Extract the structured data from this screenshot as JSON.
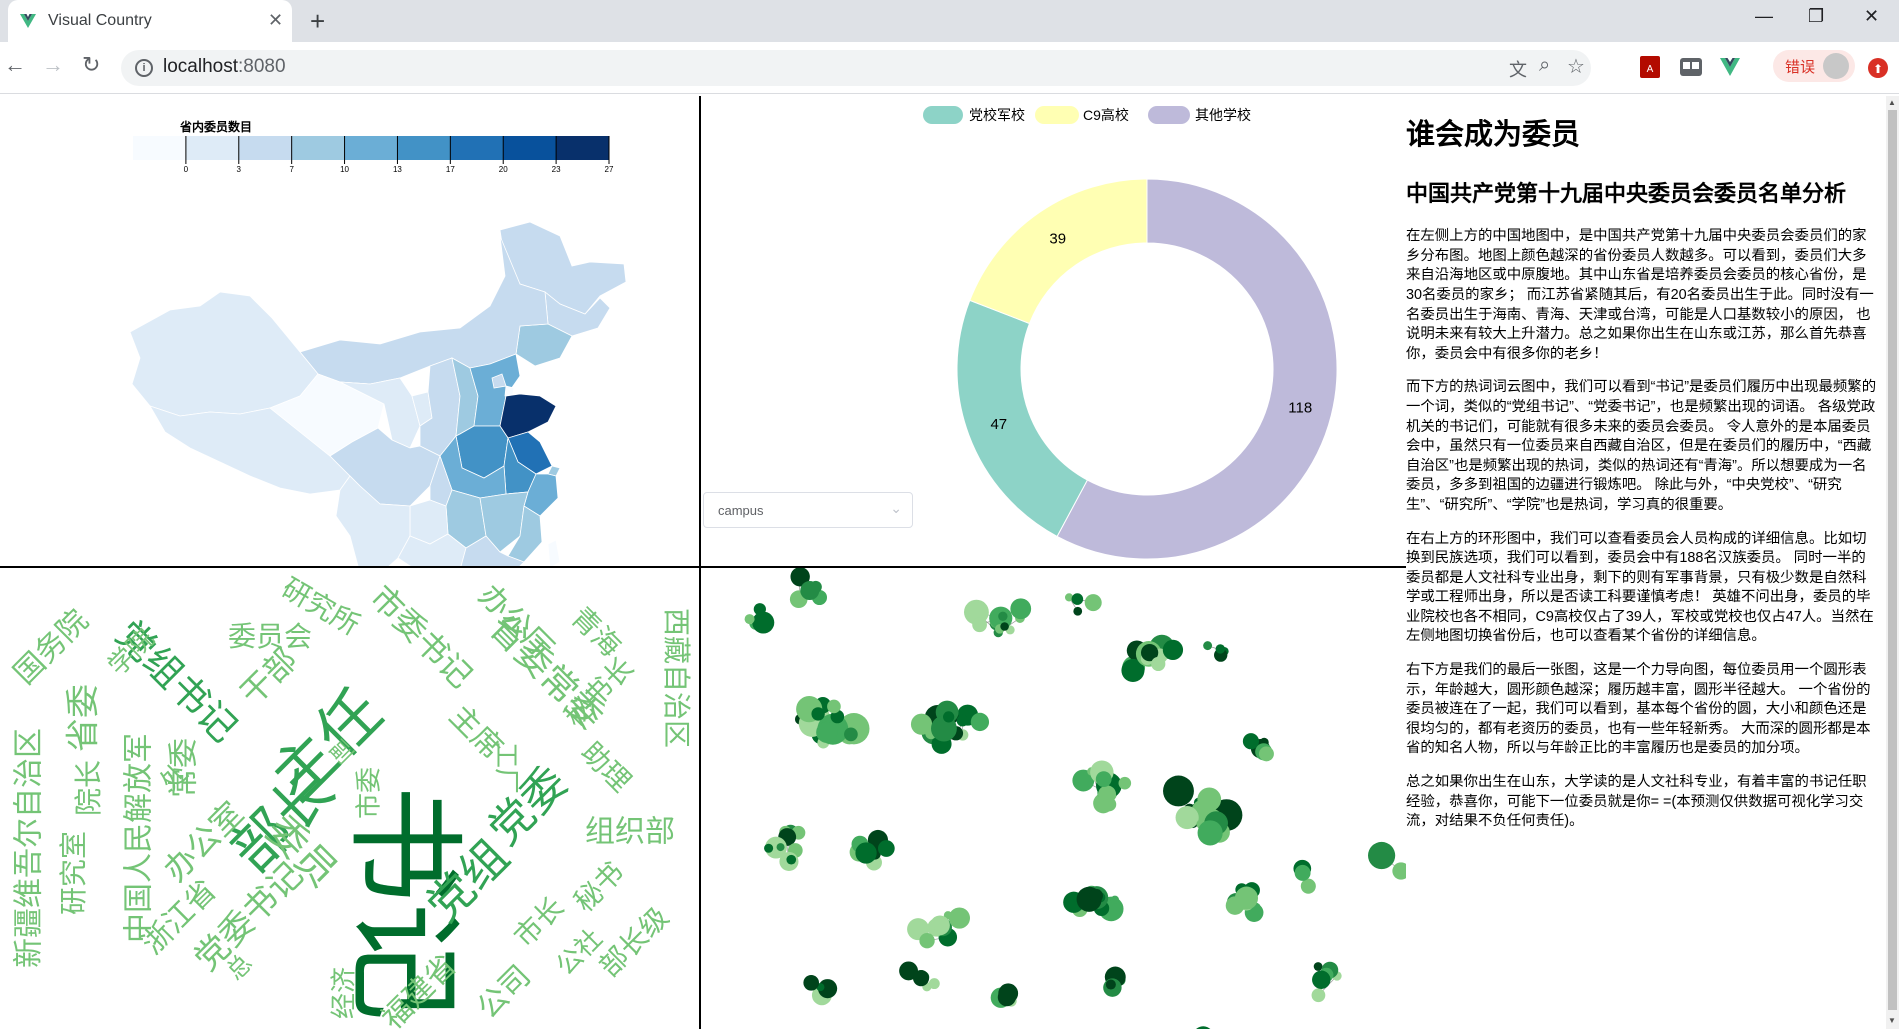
{
  "browser": {
    "tab_title": "Visual Country",
    "url_host": "localhost",
    "url_port": ":8080",
    "error_label": "错误"
  },
  "colors": {
    "map_scale": [
      "#f7fbff",
      "#deebf7",
      "#c6dbef",
      "#9ecae1",
      "#6baed6",
      "#4292c6",
      "#2171b5",
      "#08519c",
      "#08306b"
    ],
    "campus_military": "#8dd3c7",
    "campus_c9": "#ffffb3",
    "campus_other": "#bebada",
    "wordcloud_dark": "#006d2c",
    "wordcloud_mid": "#31a354",
    "wordcloud_light": "#74c476",
    "force_nodes": [
      "#00441b",
      "#006d2c",
      "#238b45",
      "#41ab5d",
      "#74c476",
      "#a1d99b"
    ]
  },
  "map": {
    "legend_title": "省内委员数目",
    "legend_ticks": [
      "0",
      "3",
      "7",
      "10",
      "13",
      "17",
      "20",
      "23",
      "27"
    ]
  },
  "donut": {
    "legend": [
      "党校军校",
      "C9高校",
      "其他学校"
    ],
    "values": [
      47,
      39,
      118
    ],
    "labels": [
      "47",
      "39",
      "118"
    ],
    "select_value": "campus"
  },
  "wordcloud": {
    "words": [
      "书记",
      "主任",
      "部长",
      "党组",
      "党委",
      "党组书记",
      "委员",
      "省委常委",
      "市委书记",
      "副",
      "中国人民解放军",
      "新疆维吾尔自治区",
      "西藏自治区",
      "办公厅",
      "研究所",
      "委员会",
      "国务院",
      "学院",
      "常委",
      "干部",
      "省委",
      "院长",
      "处",
      "研究室",
      "办公室",
      "浙江省",
      "党委书记",
      "经济",
      "福建省",
      "公司",
      "市长",
      "秘书",
      "部长级",
      "公社",
      "组织部",
      "工厂",
      "市委",
      "主席",
      "助理",
      "秘书长",
      "青海",
      "总"
    ]
  },
  "article": {
    "title": "谁会成为委员",
    "subtitle": "中国共产党第十九届中央委员会委员名单分析",
    "p1": "在左侧上方的中国地图中，是中国共产党第十九届中央委员会委员们的家乡分布图。地图上颜色越深的省份委员人数越多。可以看到，委员们大多来自沿海地区或中原腹地。其中山东省是培养委员会委员的核心省份，是30名委员的家乡； 而江苏省紧随其后，有20名委员出生于此。同时没有一名委员出生于海南、青海、天津或台湾，可能是人口基数较小的原因， 也说明未来有较大上升潜力。总之如果你出生在山东或江苏，那么首先恭喜你，委员会中有很多你的老乡！",
    "p2": "而下方的热词词云图中，我们可以看到“书记”是委员们履历中出现最频繁的一个词，类似的“党组书记”、“党委书记”，也是频繁出现的词语。 各级党政机关的书记们，可能就有很多未来的委员会委员。 令人意外的是本届委员会中，虽然只有一位委员来自西藏自治区，但是在委员们的履历中，“西藏自治区”也是频繁出现的热词，类似的热词还有“青海”。所以想要成为一名委员，多多到祖国的边疆进行锻炼吧。 除此与外，“中央党校”、“研究生”、“研究所”、“学院”也是热词，学习真的很重要。",
    "p3": "在右上方的环形图中，我们可以查看委员会人员构成的详细信息。比如切换到民族选项，我们可以看到，委员会中有188名汉族委员。 同时一半的委员都是人文社科专业出身，剩下的则有军事背景，只有极少数是自然科学或工程师出身，所以是否读工科要谨慎考虑！ 英雄不问出身，委员的毕业院校也各不相同，C9高校仅占了39人，军校或党校也仅占47人。当然在左侧地图切换省份后，也可以查看某个省份的详细信息。",
    "p4": "右下方是我们的最后一张图，这是一个力导向图，每位委员用一个圆形表示，年龄越大，圆形颜色越深；履历越丰富，圆形半径越大。 一个省份的委员被连在了一起，我们可以看到，基本每个省份的圆，大小和颜色还是很均匀的，都有老资历的委员，也有一些年轻新秀。 大而深的圆形都是本省的知名人物，所以与年龄正比的丰富履历也是委员的加分项。",
    "p5": "总之如果你出生在山东，大学读的是人文社科专业，有着丰富的书记任职经验，恭喜你，可能下一位委员就是你= =(本预测仅供数据可视化学习交流，对结果不负任何责任)。"
  }
}
